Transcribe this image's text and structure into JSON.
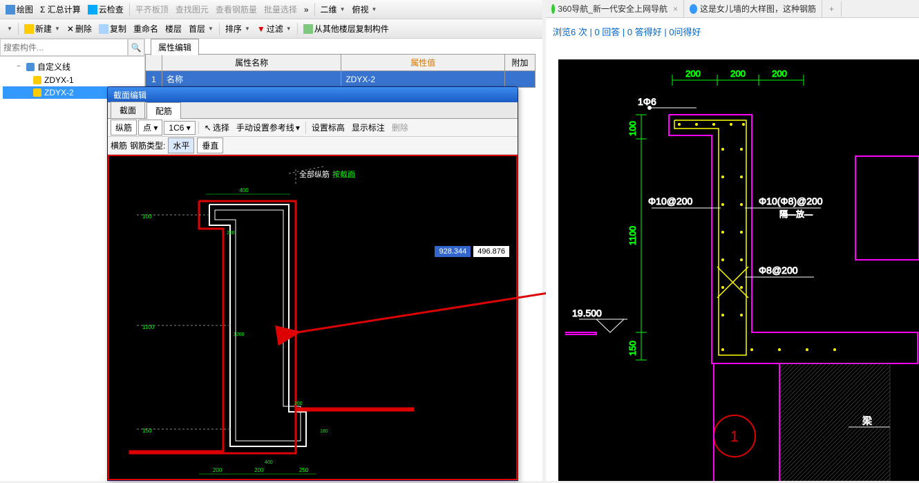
{
  "toolbar1": {
    "draw": "绘图",
    "sum": "Σ 汇总计算",
    "cloud": "云检查",
    "align": "平齐板顶",
    "find": "查找图元",
    "rebar": "查看钢筋量",
    "batch": "批量选择",
    "view2d": "二维",
    "ortho": "俯视"
  },
  "toolbar2": {
    "new": "新建",
    "delete": "删除",
    "copy": "复制",
    "rename": "重命名",
    "floor": "楼层",
    "first": "首层",
    "sort": "排序",
    "filter": "过滤",
    "copyfrom": "从其他楼层复制构件"
  },
  "search": {
    "placeholder": "搜索构件..."
  },
  "tree": {
    "root": "自定义线",
    "item1": "ZDYX-1",
    "item2": "ZDYX-2"
  },
  "prop": {
    "tab": "属性编辑",
    "col_name": "属性名称",
    "col_value": "属性值",
    "col_extra": "附加",
    "row1_num": "1",
    "row1_name": "名称",
    "row1_value": "ZDYX-2"
  },
  "section": {
    "title": "截面编辑",
    "tab1": "截面",
    "tab2": "配筋",
    "tb_vert": "纵筋",
    "tb_point": "点",
    "tb_spec": "1C6",
    "tb_select": "选择",
    "tb_manual": "手动设置参考线",
    "tb_level": "设置标高",
    "tb_show": "显示标注",
    "tb_delete": "删除",
    "tb2_horiz": "横筋",
    "tb2_type": "钢筋类型:",
    "tb2_h": "水平",
    "tb2_v": "垂直",
    "all_rebar": "全部纵筋",
    "by_section": "按截面",
    "coord1": "928.344",
    "coord2": "496.876"
  },
  "dims": {
    "d100": "100",
    "d200": "200",
    "d250": "250",
    "d400": "400",
    "d1100": "1100",
    "d1200": "1200",
    "d150": "150",
    "d180": "180"
  },
  "browser": {
    "tab1": "360导航_新一代安全上网导航",
    "tab2": "这是女儿墙的大样图，这种钢筋",
    "breadcrumb": "浏览6 次 | 0 回答 | 0 答得好 | 0问得好"
  },
  "cad": {
    "d200": "200",
    "d100": "100",
    "d1100": "1100",
    "d150": "150",
    "mark1": "1Φ6",
    "rebar1": "Φ10@200",
    "rebar2": "Φ10(Φ8)@200",
    "rebar2b": "隔—放—",
    "rebar3": "Φ8@200",
    "level": "19.500",
    "beam": "梁",
    "circle": "1"
  }
}
